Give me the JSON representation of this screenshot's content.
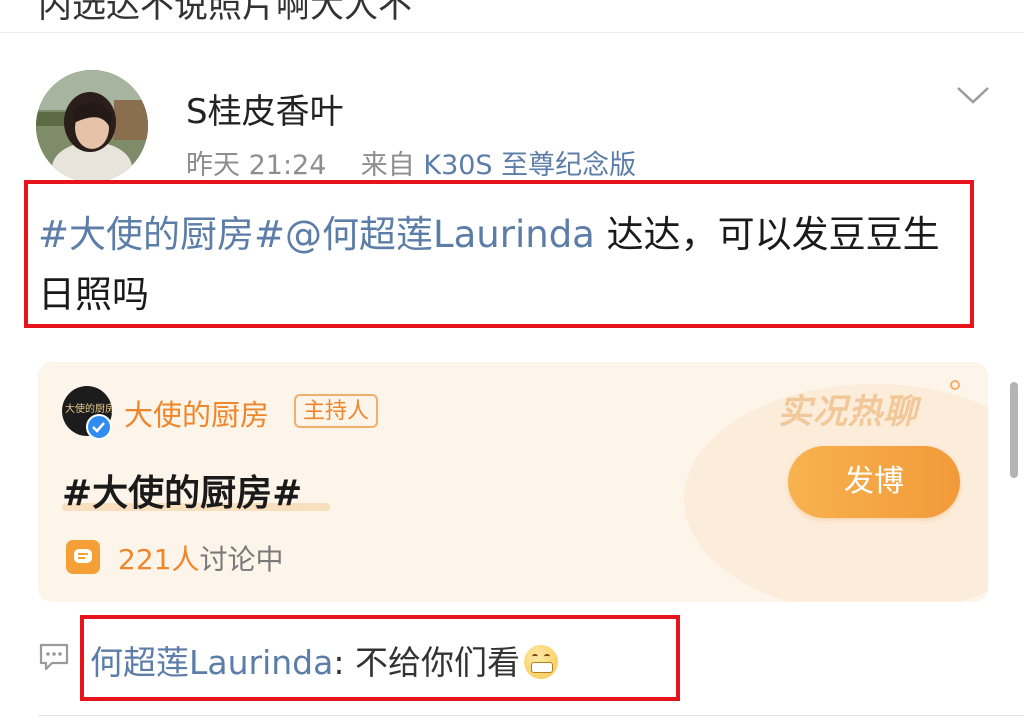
{
  "previous_post": {
    "text": "内选达不说照片啊大人不"
  },
  "post": {
    "username": "S桂皮香叶",
    "timestamp": "昨天 21:24",
    "source_prefix": "来自",
    "device": "K30S 至尊纪念版",
    "topic_link": "#大使的厨房#",
    "mention_link": "@何超莲Laurinda",
    "body_text": " 达达，可以发豆豆生日照吗"
  },
  "topic_card": {
    "avatar_text": "大使的厨房",
    "name": "大使的厨房",
    "host_badge": "主持人",
    "title": "#大使的厨房#",
    "discussion_count": "221人",
    "discussion_label": "讨论中",
    "live_chat_label": "实况热聊",
    "post_button_label": "发博"
  },
  "comment": {
    "author": "何超莲Laurinda",
    "separator": ": ",
    "text": "不给你们看"
  },
  "colors": {
    "link_blue": "#5b7da8",
    "accent_orange": "#f0862b",
    "highlight_red": "#e8141b"
  }
}
